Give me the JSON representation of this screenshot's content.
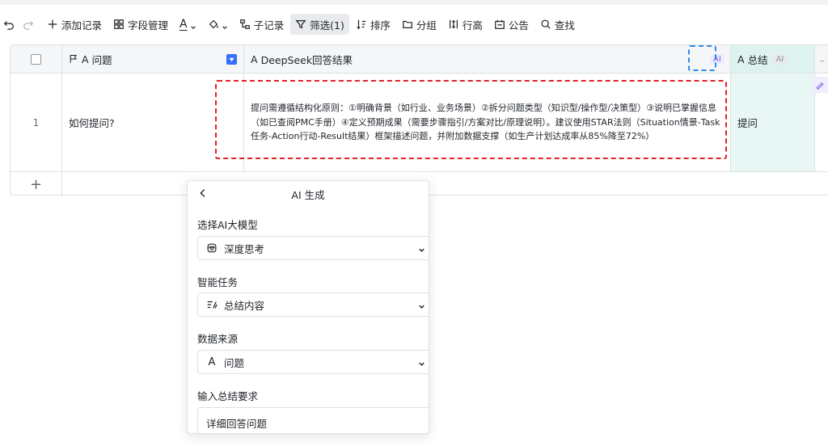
{
  "toolbar": {
    "add_record": "添加记录",
    "field_manage": "字段管理",
    "sub_record": "子记录",
    "filter": "筛选(1)",
    "sort": "排序",
    "group": "分组",
    "row_height": "行高",
    "notice": "公告",
    "find": "查找",
    "text_glyph": "A"
  },
  "table": {
    "headers": {
      "question": "问题",
      "ai_result": "DeepSeek回答结果",
      "summary": "总结",
      "ai_badge": "AI",
      "text_type_glyph": "A"
    },
    "rows": [
      {
        "index": "1",
        "question": "如何提问?",
        "answer": "提问需遵循结构化原则：①明确背景（如行业、业务场景）②拆分问题类型（知识型/操作型/决策型）③说明已掌握信息（如已查阅PMC手册）④定义预期成果（需要步骤指引/方案对比/原理说明）。建议使用STAR法则（Situation情景-Task任务-Action行动-Result结果）框架描述问题，并附加数据支撑（如生产计划达成率从85%降至72%）",
        "summary": "提问"
      }
    ],
    "add_row": "+"
  },
  "panel": {
    "title": "AI 生成",
    "model_label": "选择AI大模型",
    "model_value": "深度思考",
    "task_label": "智能任务",
    "task_value": "总结内容",
    "source_label": "数据来源",
    "source_value": "问题",
    "source_glyph": "A",
    "req_label": "输入总结要求",
    "req_value": "详细回答问题"
  },
  "colors": {
    "accent_blue": "#3370ff",
    "ai_purple": "#7b67ee",
    "annotation_red": "#e02020",
    "annotation_blue": "#2f8bf0",
    "summary_column_bg": "#e8f6f4"
  }
}
